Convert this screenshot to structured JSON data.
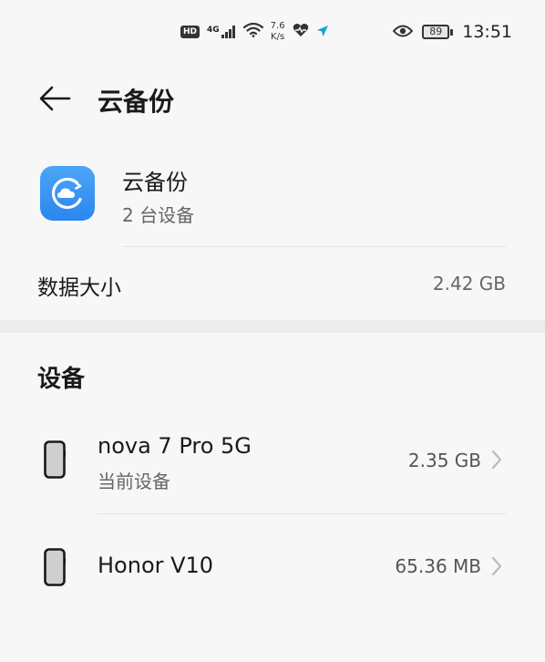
{
  "status_bar": {
    "hd_badge": "HD",
    "signal_label": "4G",
    "net_speed_value": "7.6",
    "net_speed_unit": "K/s",
    "battery_level": "89",
    "time": "13:51"
  },
  "header": {
    "title": "云备份"
  },
  "account": {
    "app_name": "云备份",
    "device_count": "2 台设备",
    "icon": "cloud-backup-icon",
    "icon_color": "#3a96f3"
  },
  "data_size": {
    "label": "数据大小",
    "value": "2.42 GB"
  },
  "devices": {
    "section_title": "设备",
    "items": [
      {
        "name": "nova 7 Pro 5G",
        "subtitle": "当前设备",
        "size": "2.35 GB"
      },
      {
        "name": "Honor V10",
        "subtitle": "",
        "size": "65.36 MB"
      }
    ]
  }
}
